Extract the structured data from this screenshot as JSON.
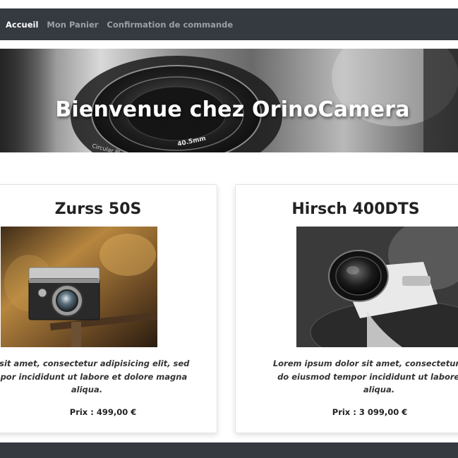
{
  "nav": {
    "items": [
      {
        "label": "Accueil",
        "active": true
      },
      {
        "label": "Mon Panier",
        "active": false
      },
      {
        "label": "Confirmation de commande",
        "active": false
      }
    ]
  },
  "hero": {
    "title": "Bienvenue chez OrinoCamera",
    "lens_text_1": "Circular PL",
    "lens_text_2": "40.5mm"
  },
  "products": [
    {
      "name": "Zurss 50S",
      "description_lines": [
        "lor sit amet, consectetur adipisicing elit, sed",
        "empor incididunt ut labore et dolore magna",
        "aliqua."
      ],
      "price": "Prix : 499,00 €"
    },
    {
      "name": "Hirsch 400DTS",
      "description_lines": [
        "Lorem ipsum dolor sit amet, consectetur adipi",
        "do eiusmod tempor incididunt ut labore et d",
        "aliqua."
      ],
      "price": "Prix : 3 099,00 €"
    }
  ],
  "colors": {
    "navbar": "#343a40",
    "nav_active": "#ffffff",
    "nav_inactive": "#9aa0a6"
  }
}
